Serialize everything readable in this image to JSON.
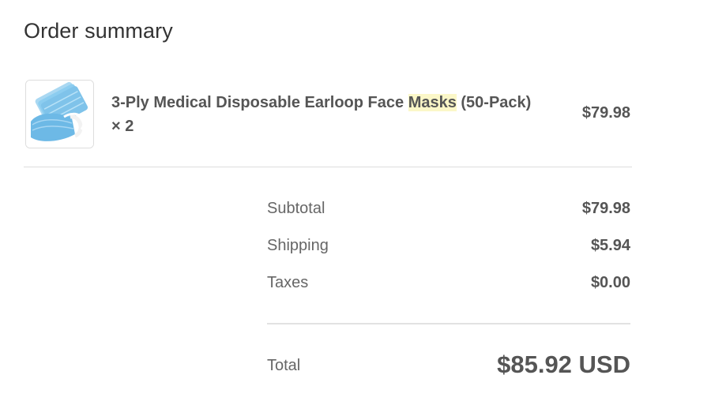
{
  "heading": "Order summary",
  "product": {
    "image_icon": "face-mask-pack-image",
    "name_before": "3-Ply Medical Disposable Earloop Face ",
    "name_highlight": "Masks",
    "name_after": " (50-Pack) × 2",
    "price": "$79.98"
  },
  "summary": {
    "subtotal_label": "Subtotal",
    "subtotal_value": "$79.98",
    "shipping_label": "Shipping",
    "shipping_value": "$5.94",
    "taxes_label": "Taxes",
    "taxes_value": "$0.00"
  },
  "total": {
    "label": "Total",
    "value": "$85.92 USD"
  },
  "colors": {
    "highlight": "#fbf7c8",
    "mask_blue": "#7fc3ea"
  }
}
